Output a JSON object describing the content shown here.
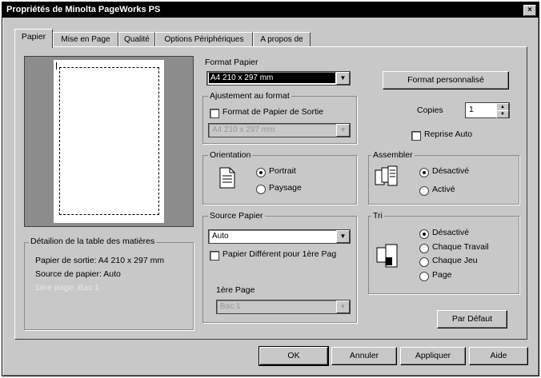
{
  "window": {
    "title": "Propriétés de Minolta PageWorks PS",
    "close_glyph": "×"
  },
  "tabs": [
    {
      "label": "Papier"
    },
    {
      "label": "Mise en Page"
    },
    {
      "label": "Qualité"
    },
    {
      "label": "Options Périphériques"
    },
    {
      "label": "A propos de"
    }
  ],
  "paper_format": {
    "label": "Format Papier",
    "value": "A4 210 x 297 mm",
    "custom_button": "Format personnalisé"
  },
  "fit": {
    "group_title": "Ajustement au format",
    "checkbox_label": "Format de Papier de Sortie",
    "value": "A4 210 x 297 mm"
  },
  "copies": {
    "label": "Copies",
    "value": "1",
    "reprint_label": "Reprise Auto"
  },
  "orientation": {
    "group_title": "Orientation",
    "options": [
      "Portrait",
      "Paysage"
    ],
    "selected": "Portrait"
  },
  "collate": {
    "group_title": "Assembler",
    "options": [
      "Désactivé",
      "Activé"
    ],
    "selected": "Désactivé"
  },
  "source": {
    "group_title": "Source Papier",
    "value": "Auto",
    "diff_first_label": "Papier Différent pour 1ère Pag",
    "first_page_label": "1ère Page",
    "first_page_value": "Bac 1"
  },
  "sort": {
    "group_title": "Tri",
    "options": [
      "Désactivé",
      "Chaque Travail",
      "Chaque Jeu",
      "Page"
    ],
    "selected": "Désactivé"
  },
  "details": {
    "group_title": "Détailion de la table des matières",
    "lines": [
      "Papier de sortie: A4  210 x 297 mm",
      "Source de papier: Auto",
      "1ère page: Bac 1"
    ]
  },
  "buttons": {
    "defaults": "Par Défaut",
    "ok": "OK",
    "cancel": "Annuler",
    "apply": "Appliquer",
    "help": "Aide"
  }
}
